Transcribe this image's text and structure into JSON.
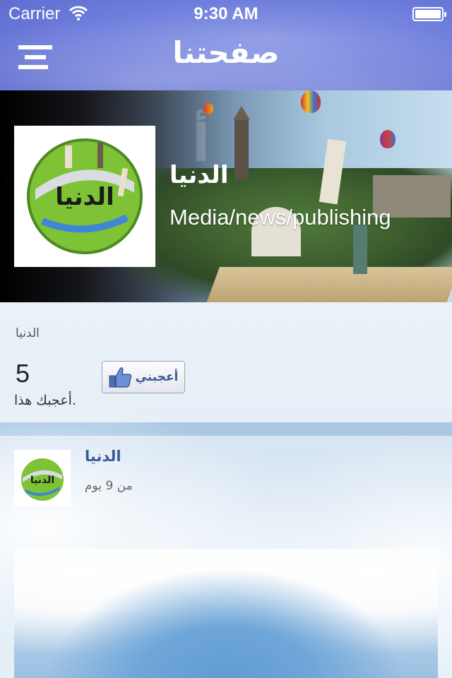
{
  "status_bar": {
    "carrier": "Carrier",
    "time": "9:30 AM"
  },
  "nav": {
    "title": "صفحتنا",
    "menu_icon": "menu-icon"
  },
  "cover": {
    "avatar_text": "الدنيا",
    "page_name": "الدنيا",
    "category": "Media/news/publishing"
  },
  "like_box": {
    "page_label": "الدنيا",
    "count": "5",
    "caption": "أعجبك هذا.",
    "button_label": "أعجبني",
    "button_icon": "thumbs-up-icon"
  },
  "post": {
    "avatar_text": "الدنيا",
    "author": "الدنيا",
    "time": "من 9 يوم"
  },
  "colors": {
    "nav_bar": "#6f7fdc",
    "link": "#3b5998"
  }
}
